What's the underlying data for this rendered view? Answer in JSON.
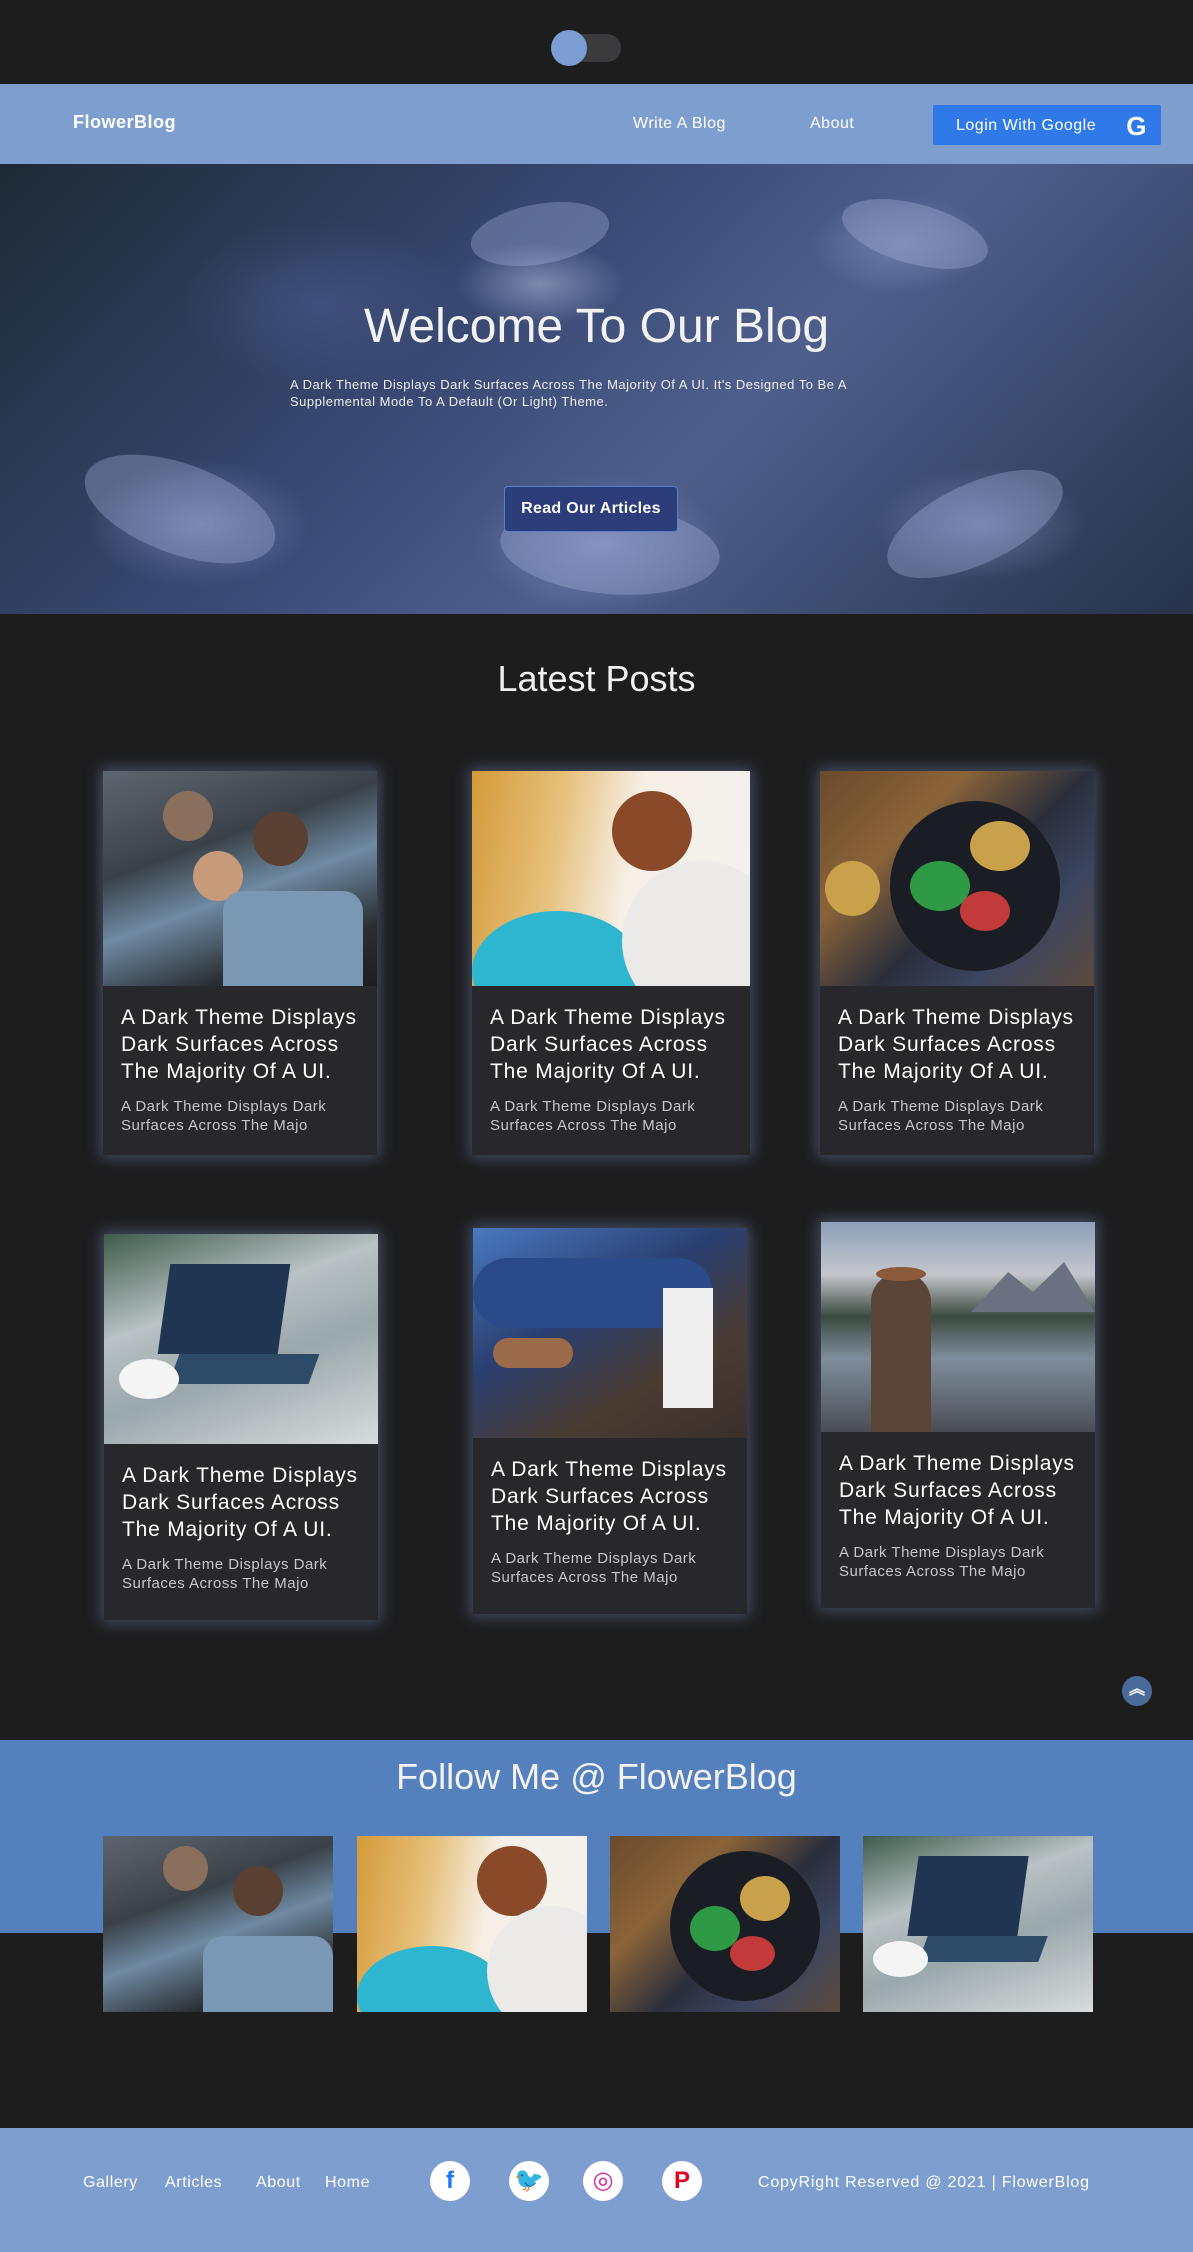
{
  "header": {
    "brand": "FlowerBlog",
    "nav": [
      "Write A Blog",
      "About"
    ],
    "login_label": "Login With Google",
    "login_icon": "google-icon"
  },
  "hero": {
    "title": "Welcome To Our Blog",
    "subtitle": "A Dark Theme Displays Dark Surfaces Across The Majority Of A UI. It's Designed To Be A Supplemental Mode To A Default (Or Light) Theme.",
    "cta": "Read Our Articles"
  },
  "latest": {
    "title": "Latest Posts",
    "posts": [
      {
        "title": "A Dark Theme Displays Dark Surfaces Across The Majority Of A UI.",
        "excerpt": "A Dark Theme Displays Dark Surfaces Across The Majo",
        "image": "group-of-friends"
      },
      {
        "title": "A Dark Theme Displays Dark Surfaces Across The Majority Of A UI.",
        "excerpt": "A Dark Theme Displays Dark Surfaces Across The Majo",
        "image": "child-with-balloon"
      },
      {
        "title": "A Dark Theme Displays Dark Surfaces Across The Majority Of A UI.",
        "excerpt": "A Dark Theme Displays Dark Surfaces Across The Majo",
        "image": "food-bowl"
      },
      {
        "title": "A Dark Theme Displays Dark Surfaces Across The Majority Of A UI.",
        "excerpt": "A Dark Theme Displays Dark Surfaces Across The Majo",
        "image": "laptop-and-coffee"
      },
      {
        "title": "A Dark Theme Displays Dark Surfaces Across The Majority Of A UI.",
        "excerpt": "A Dark Theme Displays Dark Surfaces Across The Majo",
        "image": "yoga-with-water-carton"
      },
      {
        "title": "A Dark Theme Displays Dark Surfaces Across The Majority Of A UI.",
        "excerpt": "A Dark Theme Displays Dark Surfaces Across The Majo",
        "image": "woman-by-lake"
      }
    ]
  },
  "follow": {
    "title": "Follow Me @ FlowerBlog",
    "images": [
      "group-of-friends",
      "child-with-balloon",
      "food-bowl",
      "laptop-and-coffee"
    ]
  },
  "footer": {
    "links": [
      "Gallery",
      "Articles",
      "About",
      "Home"
    ],
    "social": [
      "facebook-icon",
      "twitter-icon",
      "instagram-icon",
      "pinterest-icon"
    ],
    "copyright": "CopyRight Reserved @ 2021 | FlowerBlog"
  },
  "colors": {
    "background": "#1d1d1e",
    "navbar": "#7e9ed0",
    "accent_button": "#2f7ae8",
    "follow_band": "#5580be",
    "card": "#28282c"
  }
}
